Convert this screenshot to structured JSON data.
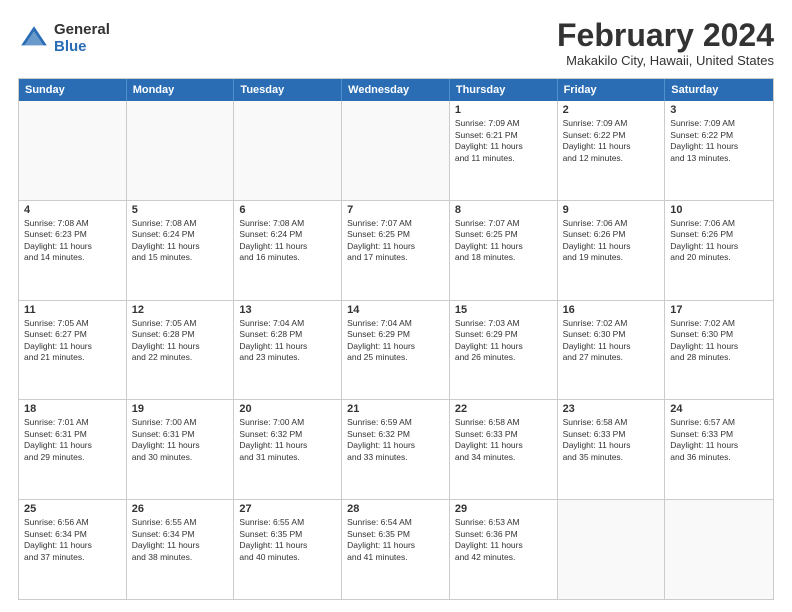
{
  "logo": {
    "general": "General",
    "blue": "Blue"
  },
  "title": "February 2024",
  "subtitle": "Makakilo City, Hawaii, United States",
  "days": [
    "Sunday",
    "Monday",
    "Tuesday",
    "Wednesday",
    "Thursday",
    "Friday",
    "Saturday"
  ],
  "weeks": [
    [
      {
        "day": "",
        "info": ""
      },
      {
        "day": "",
        "info": ""
      },
      {
        "day": "",
        "info": ""
      },
      {
        "day": "",
        "info": ""
      },
      {
        "day": "1",
        "info": "Sunrise: 7:09 AM\nSunset: 6:21 PM\nDaylight: 11 hours\nand 11 minutes."
      },
      {
        "day": "2",
        "info": "Sunrise: 7:09 AM\nSunset: 6:22 PM\nDaylight: 11 hours\nand 12 minutes."
      },
      {
        "day": "3",
        "info": "Sunrise: 7:09 AM\nSunset: 6:22 PM\nDaylight: 11 hours\nand 13 minutes."
      }
    ],
    [
      {
        "day": "4",
        "info": "Sunrise: 7:08 AM\nSunset: 6:23 PM\nDaylight: 11 hours\nand 14 minutes."
      },
      {
        "day": "5",
        "info": "Sunrise: 7:08 AM\nSunset: 6:24 PM\nDaylight: 11 hours\nand 15 minutes."
      },
      {
        "day": "6",
        "info": "Sunrise: 7:08 AM\nSunset: 6:24 PM\nDaylight: 11 hours\nand 16 minutes."
      },
      {
        "day": "7",
        "info": "Sunrise: 7:07 AM\nSunset: 6:25 PM\nDaylight: 11 hours\nand 17 minutes."
      },
      {
        "day": "8",
        "info": "Sunrise: 7:07 AM\nSunset: 6:25 PM\nDaylight: 11 hours\nand 18 minutes."
      },
      {
        "day": "9",
        "info": "Sunrise: 7:06 AM\nSunset: 6:26 PM\nDaylight: 11 hours\nand 19 minutes."
      },
      {
        "day": "10",
        "info": "Sunrise: 7:06 AM\nSunset: 6:26 PM\nDaylight: 11 hours\nand 20 minutes."
      }
    ],
    [
      {
        "day": "11",
        "info": "Sunrise: 7:05 AM\nSunset: 6:27 PM\nDaylight: 11 hours\nand 21 minutes."
      },
      {
        "day": "12",
        "info": "Sunrise: 7:05 AM\nSunset: 6:28 PM\nDaylight: 11 hours\nand 22 minutes."
      },
      {
        "day": "13",
        "info": "Sunrise: 7:04 AM\nSunset: 6:28 PM\nDaylight: 11 hours\nand 23 minutes."
      },
      {
        "day": "14",
        "info": "Sunrise: 7:04 AM\nSunset: 6:29 PM\nDaylight: 11 hours\nand 25 minutes."
      },
      {
        "day": "15",
        "info": "Sunrise: 7:03 AM\nSunset: 6:29 PM\nDaylight: 11 hours\nand 26 minutes."
      },
      {
        "day": "16",
        "info": "Sunrise: 7:02 AM\nSunset: 6:30 PM\nDaylight: 11 hours\nand 27 minutes."
      },
      {
        "day": "17",
        "info": "Sunrise: 7:02 AM\nSunset: 6:30 PM\nDaylight: 11 hours\nand 28 minutes."
      }
    ],
    [
      {
        "day": "18",
        "info": "Sunrise: 7:01 AM\nSunset: 6:31 PM\nDaylight: 11 hours\nand 29 minutes."
      },
      {
        "day": "19",
        "info": "Sunrise: 7:00 AM\nSunset: 6:31 PM\nDaylight: 11 hours\nand 30 minutes."
      },
      {
        "day": "20",
        "info": "Sunrise: 7:00 AM\nSunset: 6:32 PM\nDaylight: 11 hours\nand 31 minutes."
      },
      {
        "day": "21",
        "info": "Sunrise: 6:59 AM\nSunset: 6:32 PM\nDaylight: 11 hours\nand 33 minutes."
      },
      {
        "day": "22",
        "info": "Sunrise: 6:58 AM\nSunset: 6:33 PM\nDaylight: 11 hours\nand 34 minutes."
      },
      {
        "day": "23",
        "info": "Sunrise: 6:58 AM\nSunset: 6:33 PM\nDaylight: 11 hours\nand 35 minutes."
      },
      {
        "day": "24",
        "info": "Sunrise: 6:57 AM\nSunset: 6:33 PM\nDaylight: 11 hours\nand 36 minutes."
      }
    ],
    [
      {
        "day": "25",
        "info": "Sunrise: 6:56 AM\nSunset: 6:34 PM\nDaylight: 11 hours\nand 37 minutes."
      },
      {
        "day": "26",
        "info": "Sunrise: 6:55 AM\nSunset: 6:34 PM\nDaylight: 11 hours\nand 38 minutes."
      },
      {
        "day": "27",
        "info": "Sunrise: 6:55 AM\nSunset: 6:35 PM\nDaylight: 11 hours\nand 40 minutes."
      },
      {
        "day": "28",
        "info": "Sunrise: 6:54 AM\nSunset: 6:35 PM\nDaylight: 11 hours\nand 41 minutes."
      },
      {
        "day": "29",
        "info": "Sunrise: 6:53 AM\nSunset: 6:36 PM\nDaylight: 11 hours\nand 42 minutes."
      },
      {
        "day": "",
        "info": ""
      },
      {
        "day": "",
        "info": ""
      }
    ]
  ]
}
